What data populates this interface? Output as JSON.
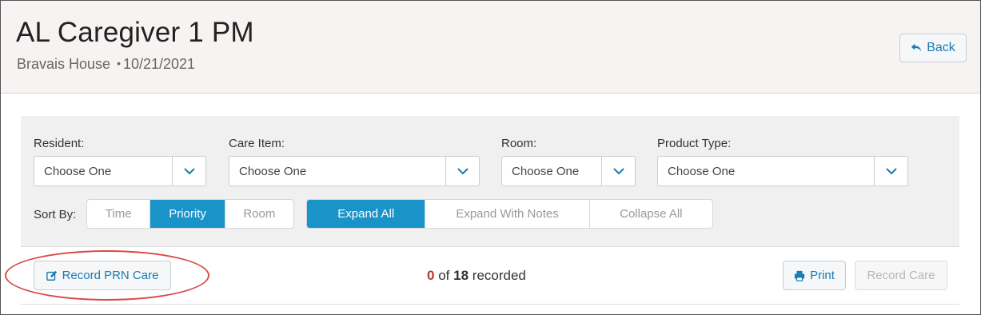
{
  "header": {
    "title": "AL Caregiver 1 PM",
    "facility": "Bravais House",
    "separator": "•",
    "date": "10/21/2021",
    "back_label": "Back"
  },
  "filters": {
    "resident": {
      "label": "Resident:",
      "value": "Choose One"
    },
    "care_item": {
      "label": "Care Item:",
      "value": "Choose One"
    },
    "room": {
      "label": "Room:",
      "value": "Choose One"
    },
    "product_type": {
      "label": "Product Type:",
      "value": "Choose One"
    }
  },
  "sort": {
    "label": "Sort By:",
    "options": [
      "Time",
      "Priority",
      "Room"
    ],
    "selected": "Priority"
  },
  "expand": {
    "options": [
      "Expand All",
      "Expand With Notes",
      "Collapse All"
    ],
    "selected": "Expand All"
  },
  "actions": {
    "record_prn_label": "Record PRN Care",
    "recorded_count": "0",
    "of_text": "of",
    "total_count": "18",
    "recorded_text": "recorded",
    "print_label": "Print",
    "record_care_label": "Record Care"
  },
  "colors": {
    "accent": "#1a93c8",
    "link": "#1a7bb0",
    "highlight": "#d94a47",
    "zero_count": "#b53a2e"
  }
}
